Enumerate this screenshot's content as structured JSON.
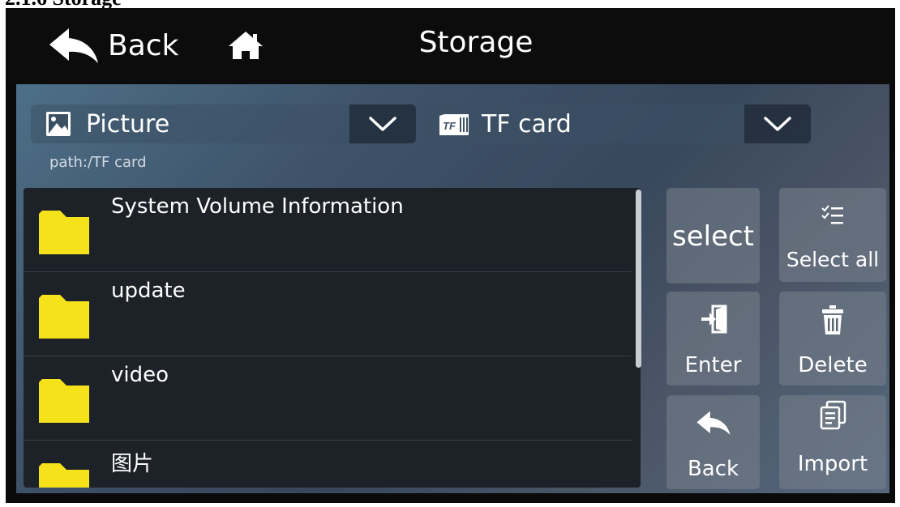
{
  "doc_heading": "2.1.6 Storage",
  "header": {
    "back_label": "Back",
    "title": "Storage",
    "back_icon": "back-arrow-icon",
    "home_icon": "home-icon"
  },
  "type_dropdown": {
    "label": "Picture",
    "icon": "picture-icon"
  },
  "source_dropdown": {
    "label": "TF card",
    "icon": "tf-card-icon",
    "icon_text": "TF"
  },
  "path": "path:/TF card",
  "files": [
    {
      "name": "System Volume Information",
      "icon": "folder-icon"
    },
    {
      "name": "update",
      "icon": "folder-icon"
    },
    {
      "name": "video",
      "icon": "folder-icon"
    },
    {
      "name": "图片",
      "icon": "folder-icon"
    }
  ],
  "actions": {
    "select": "select",
    "select_all": "Select all",
    "enter": "Enter",
    "delete": "Delete",
    "back": "Back",
    "import": "Import"
  },
  "colors": {
    "folder": "#f5e21a",
    "panel_gradient_start": "#4d6f88",
    "list_background": "#1d2128",
    "button_background": "#7a828c"
  }
}
